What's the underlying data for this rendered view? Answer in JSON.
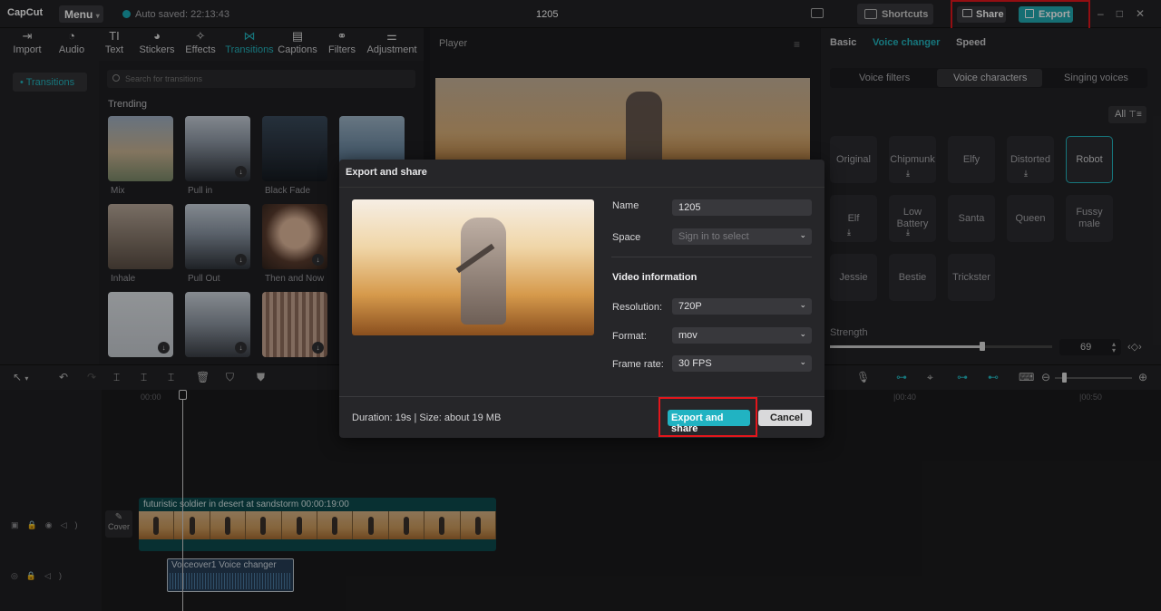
{
  "app": {
    "logo": "CapCut",
    "menu_label": "Menu",
    "autosave": "Auto saved: 22:13:43",
    "project_title": "1205",
    "shortcuts_label": "Shortcuts",
    "share_label": "Share",
    "export_label": "Export"
  },
  "toolbar": {
    "items": [
      {
        "label": "Import",
        "icon": "import-icon"
      },
      {
        "label": "Audio",
        "icon": "audio-icon"
      },
      {
        "label": "Text",
        "icon": "text-icon"
      },
      {
        "label": "Stickers",
        "icon": "stickers-icon"
      },
      {
        "label": "Effects",
        "icon": "effects-icon"
      },
      {
        "label": "Transitions",
        "icon": "transitions-icon"
      },
      {
        "label": "Captions",
        "icon": "captions-icon"
      },
      {
        "label": "Filters",
        "icon": "filters-icon"
      },
      {
        "label": "Adjustment",
        "icon": "adjustment-icon"
      }
    ],
    "active": "Transitions"
  },
  "sidebar": {
    "item": "• Transitions"
  },
  "transitions": {
    "search_placeholder": "Search for transitions",
    "section": "Trending",
    "items": [
      "Mix",
      "Pull in",
      "Black Fade",
      "Inhale",
      "Pull Out",
      "Then and Now"
    ]
  },
  "player": {
    "title": "Player"
  },
  "right_panel": {
    "tabs": [
      "Basic",
      "Voice changer",
      "Speed"
    ],
    "subtabs": [
      "Voice filters",
      "Voice characters",
      "Singing voices"
    ],
    "filter_label": "All",
    "voices": [
      "Original",
      "Chipmunk",
      "Elfy",
      "Distorted",
      "Robot",
      "Elf",
      "Low Battery",
      "Santa",
      "Queen",
      "Fussy male",
      "Jessie",
      "Bestie",
      "Trickster"
    ],
    "selected_voice": "Robot",
    "strength_label": "Strength",
    "strength_value": "69",
    "strength_fraction": 0.69
  },
  "timeline": {
    "ticks": [
      "00:00",
      "|00:40",
      "|00:50"
    ],
    "cover_label": "Cover",
    "video_clip_label": "futuristic soldier in desert at sandstorm   00:00:19:00",
    "audio_clip_label": "Voiceover1    Voice changer"
  },
  "dialog": {
    "title": "Export and share",
    "name_label": "Name",
    "name_value": "1205",
    "space_label": "Space",
    "space_placeholder": "Sign in to select",
    "video_info_heading": "Video information",
    "resolution_label": "Resolution:",
    "resolution_value": "720P",
    "format_label": "Format:",
    "format_value": "mov",
    "framerate_label": "Frame rate:",
    "framerate_value": "30 FPS",
    "footer_info": "Duration: 19s | Size: about 19 MB",
    "export_share_label": "Export and share",
    "cancel_label": "Cancel"
  }
}
